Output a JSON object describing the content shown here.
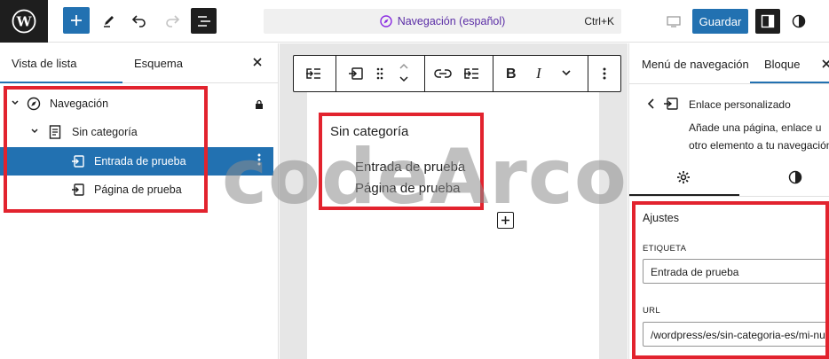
{
  "topbar": {
    "command_title": "Navegación (español)",
    "command_shortcut": "Ctrl+K",
    "save_label": "Guardar"
  },
  "left_panel": {
    "tabs": [
      "Vista de lista",
      "Esquema"
    ],
    "tree": [
      {
        "label": "Navegación",
        "level": 0
      },
      {
        "label": "Sin categoría",
        "level": 1
      },
      {
        "label": "Entrada de prueba",
        "level": 2,
        "selected": true
      },
      {
        "label": "Página de prueba",
        "level": 2
      }
    ]
  },
  "canvas": {
    "heading": "Sin categoría",
    "items": [
      "Entrada de prueba",
      "Página de prueba"
    ]
  },
  "right_panel": {
    "tabs": [
      "Menú de navegación",
      "Bloque"
    ],
    "block_title": "Enlace personalizado",
    "block_desc_1": "Añade una página, enlace u",
    "block_desc_2": "otro elemento a tu navegación.",
    "section_title": "Ajustes",
    "label_field_label": "ETIQUETA",
    "label_field_value": "Entrada de prueba",
    "url_field_label": "URL",
    "url_field_value": "/wordpress/es/sin-categoria-es/mi-nueva-entrada/"
  },
  "watermark": "codeArco",
  "colors": {
    "accent": "#2271b1",
    "highlight": "#e2232e",
    "dark": "#1e1e1e"
  }
}
